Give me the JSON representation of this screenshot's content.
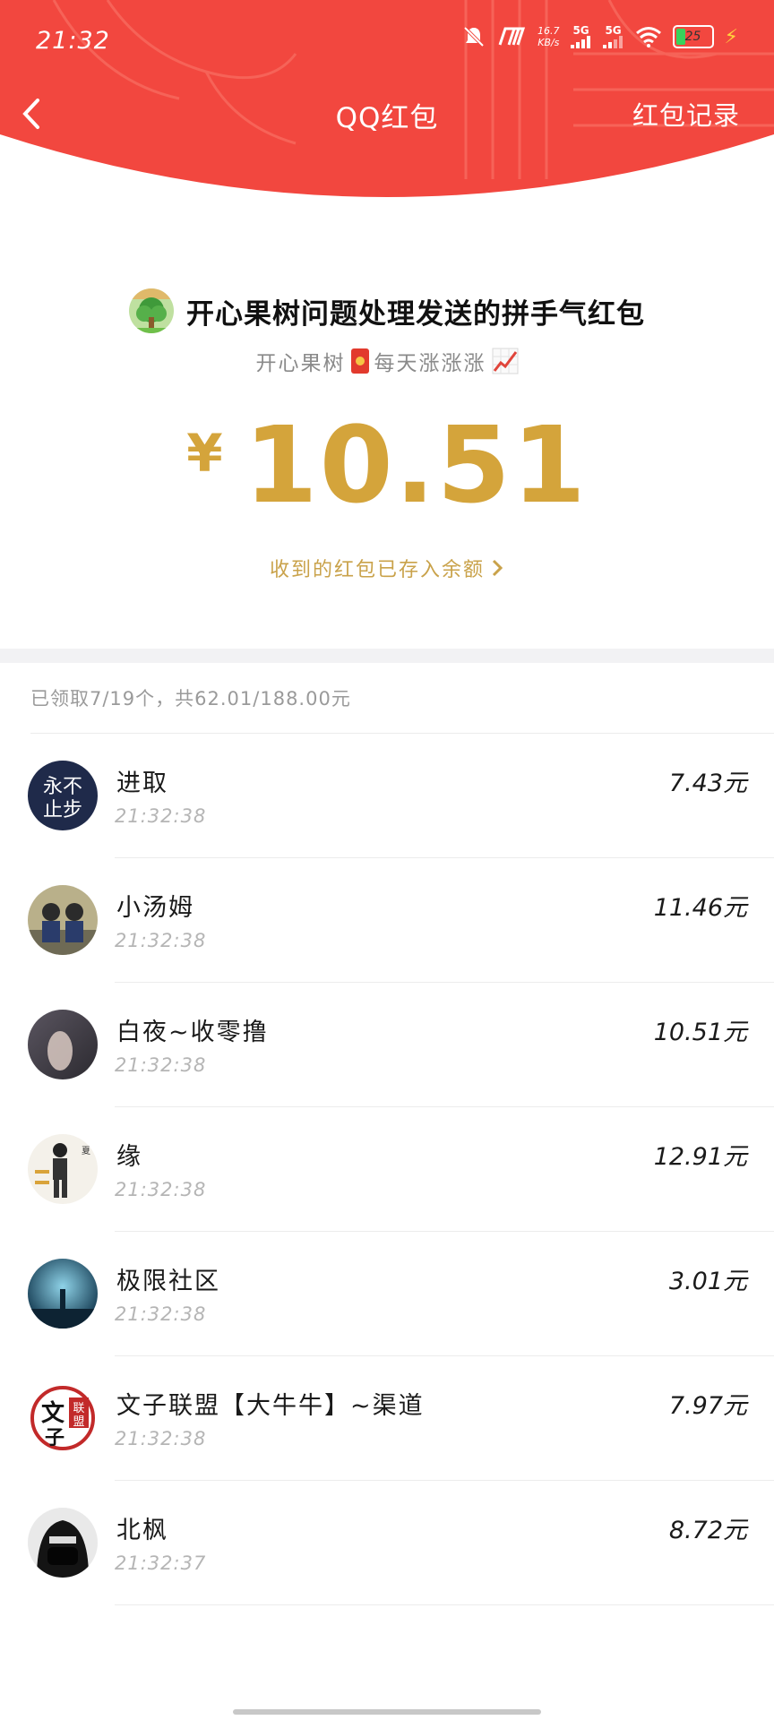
{
  "status_bar": {
    "time": "21:32",
    "net_speed_value": "16.7",
    "net_speed_unit": "KB/s",
    "sim1_label": "5G",
    "sim2_label": "5G",
    "battery_level": "25",
    "icons": [
      "mute-bell-icon",
      "nfc-icon",
      "signal-icon",
      "wifi-icon",
      "battery-icon",
      "charging-icon"
    ]
  },
  "nav": {
    "back_icon": "chevron-left-icon",
    "title": "QQ红包",
    "records_label": "红包记录"
  },
  "packet": {
    "sender_title": "开心果树问题处理发送的拼手气红包",
    "wish_prefix": "开心果树",
    "wish_suffix": "每天涨涨涨",
    "currency": "¥",
    "amount": "10.51",
    "saved_text": "收到的红包已存入余额"
  },
  "summary": {
    "count_text": "已领取7/19个，共62.01/188.00元"
  },
  "receivers": [
    {
      "name": "进取",
      "time": "21:32:38",
      "amount": "7.43元"
    },
    {
      "name": "小汤姆",
      "time": "21:32:38",
      "amount": "11.46元"
    },
    {
      "name": "白夜~收零撸",
      "time": "21:32:38",
      "amount": "10.51元"
    },
    {
      "name": "缘",
      "time": "21:32:38",
      "amount": "12.91元"
    },
    {
      "name": "极限社区",
      "time": "21:32:38",
      "amount": "3.01元"
    },
    {
      "name": "文子联盟【大牛牛】~渠道",
      "time": "21:32:38",
      "amount": "7.97元"
    },
    {
      "name": "北枫",
      "time": "21:32:37",
      "amount": "8.72元"
    }
  ],
  "colors": {
    "header_red": "#f2473f",
    "gold": "#d4a43b",
    "link_gold": "#c9a24a"
  }
}
